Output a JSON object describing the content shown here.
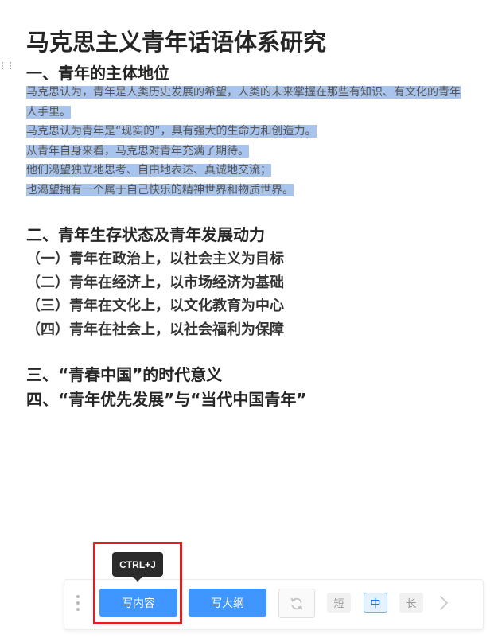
{
  "document": {
    "title": "马克思主义青年话语体系研究",
    "section1": {
      "heading": "一、青年的主体地位",
      "selected_lines": [
        "马克思认为，青年是人类历史发展的希望，人类的未来掌握在那些有知识、有文化的青年",
        "人手里。",
        "马克思认为青年是“现实的”，具有强大的生命力和创造力。",
        "从青年自身来看，马克思对青年充满了期待。",
        "他们渴望独立地思考、自由地表达、真诚地交流；",
        "也渴望拥有一个属于自己快乐的精神世界和物质世界。"
      ]
    },
    "section2": {
      "heading": "二、青年生存状态及青年发展动力",
      "items": [
        "（一）青年在政治上，以社会主义为目标",
        "（二）青年在经济上，以市场经济为基础",
        "（三）青年在文化上，以文化教育为中心",
        "（四）青年在社会上，以社会福利为保障"
      ]
    },
    "section3": {
      "heading": "三、“青春中国”的时代意义"
    },
    "section4": {
      "heading": "四、“青年优先发展”与“当代中国青年”"
    }
  },
  "toolbar": {
    "write_content_label": "写内容",
    "write_outline_label": "写大纲",
    "refresh_icon": "refresh-icon",
    "length_short": "短",
    "length_medium": "中",
    "length_long": "长",
    "selected_length": "中",
    "next_icon": "chevron-right-icon",
    "drag_icon": "drag-dots-icon"
  },
  "tooltip": {
    "shortcut": "CTRL+J"
  },
  "colors": {
    "accent": "#4096ff",
    "selection": "#a9c4ec",
    "highlight_border": "#e02020",
    "tooltip_bg": "#2b2b2b"
  }
}
